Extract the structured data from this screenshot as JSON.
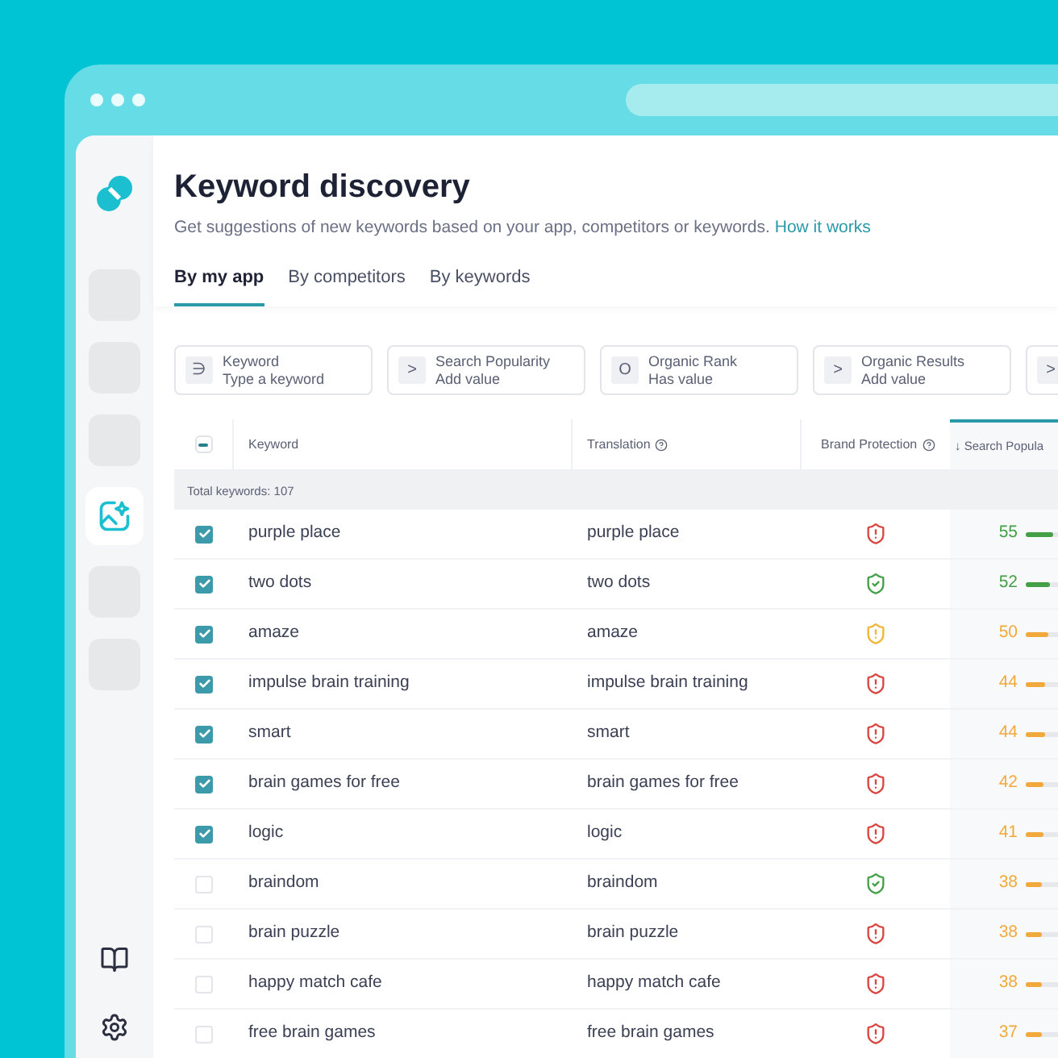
{
  "header": {
    "title": "Keyword discovery",
    "subtitle": "Get suggestions of new keywords based on your app, competitors or keywords.",
    "link": "How it works"
  },
  "sidebar": {
    "items": [
      {
        "selected": false
      },
      {
        "selected": false
      },
      {
        "selected": false
      },
      {
        "selected": true
      },
      {
        "selected": false
      },
      {
        "selected": false
      }
    ]
  },
  "tabs": [
    {
      "label": "By my app",
      "selected": true
    },
    {
      "label": "By competitors",
      "selected": false
    },
    {
      "label": "By keywords",
      "selected": false
    }
  ],
  "filters": [
    {
      "symbol": "∋",
      "label": "Keyword",
      "value": "Type a keyword"
    },
    {
      "symbol": ">",
      "label": "Search Popularity",
      "value": "Add value"
    },
    {
      "symbol": "O",
      "label": "Organic Rank",
      "value": "Has value"
    },
    {
      "symbol": ">",
      "label": "Organic Results",
      "value": "Add value"
    },
    {
      "symbol": ">"
    }
  ],
  "table": {
    "select_all": {
      "indeterminate": true
    },
    "columns": [
      {
        "label": "Keyword",
        "help": false,
        "sorted": false
      },
      {
        "label": "Translation",
        "help": true,
        "sorted": false
      },
      {
        "label": "Brand Protection",
        "help": true,
        "sorted": false
      },
      {
        "label": "↓ Search Popula",
        "help": false,
        "sorted": true
      }
    ],
    "total": "Total keywords: 107",
    "rows": [
      {
        "checked": true,
        "keyword": "purple place",
        "translation": "purple place",
        "protection": {
          "color": "#d9453f"
        },
        "popularity": {
          "value": "55",
          "color": "#43a047",
          "level": 0.6
        }
      },
      {
        "checked": true,
        "keyword": "two dots",
        "translation": "two dots",
        "protection": {
          "color": "#43a047"
        },
        "popularity": {
          "value": "52",
          "color": "#43a047",
          "level": 0.55
        }
      },
      {
        "checked": true,
        "keyword": "amaze",
        "translation": "amaze",
        "protection": {
          "color": "#f2b533"
        },
        "popularity": {
          "value": "50",
          "color": "#f2a93b",
          "level": 0.5
        }
      },
      {
        "checked": true,
        "keyword": "impulse brain training",
        "translation": "impulse brain training",
        "protection": {
          "color": "#d9453f"
        },
        "popularity": {
          "value": "44",
          "color": "#f2a93b",
          "level": 0.42
        }
      },
      {
        "checked": true,
        "keyword": "smart",
        "translation": "smart",
        "protection": {
          "color": "#d9453f"
        },
        "popularity": {
          "value": "44",
          "color": "#f2a93b",
          "level": 0.42
        }
      },
      {
        "checked": true,
        "keyword": "brain games for free",
        "translation": "brain games for free",
        "protection": {
          "color": "#d9453f"
        },
        "popularity": {
          "value": "42",
          "color": "#f2a93b",
          "level": 0.4
        }
      },
      {
        "checked": true,
        "keyword": "logic",
        "translation": "logic",
        "protection": {
          "color": "#d9453f"
        },
        "popularity": {
          "value": "41",
          "color": "#f2a93b",
          "level": 0.39
        }
      },
      {
        "checked": false,
        "keyword": "braindom",
        "translation": "braindom",
        "protection": {
          "color": "#43a047"
        },
        "popularity": {
          "value": "38",
          "color": "#f2a93b",
          "level": 0.35
        }
      },
      {
        "checked": false,
        "keyword": "brain puzzle",
        "translation": "brain puzzle",
        "protection": {
          "color": "#d9453f"
        },
        "popularity": {
          "value": "38",
          "color": "#f2a93b",
          "level": 0.35
        }
      },
      {
        "checked": false,
        "keyword": "happy match cafe",
        "translation": "happy match cafe",
        "protection": {
          "color": "#d9453f"
        },
        "popularity": {
          "value": "38",
          "color": "#f2a93b",
          "level": 0.35
        }
      },
      {
        "checked": false,
        "keyword": "free brain games",
        "translation": "free brain games",
        "protection": {
          "color": "#d9453f"
        },
        "popularity": {
          "value": "37",
          "color": "#f2a93b",
          "level": 0.34
        }
      }
    ]
  }
}
